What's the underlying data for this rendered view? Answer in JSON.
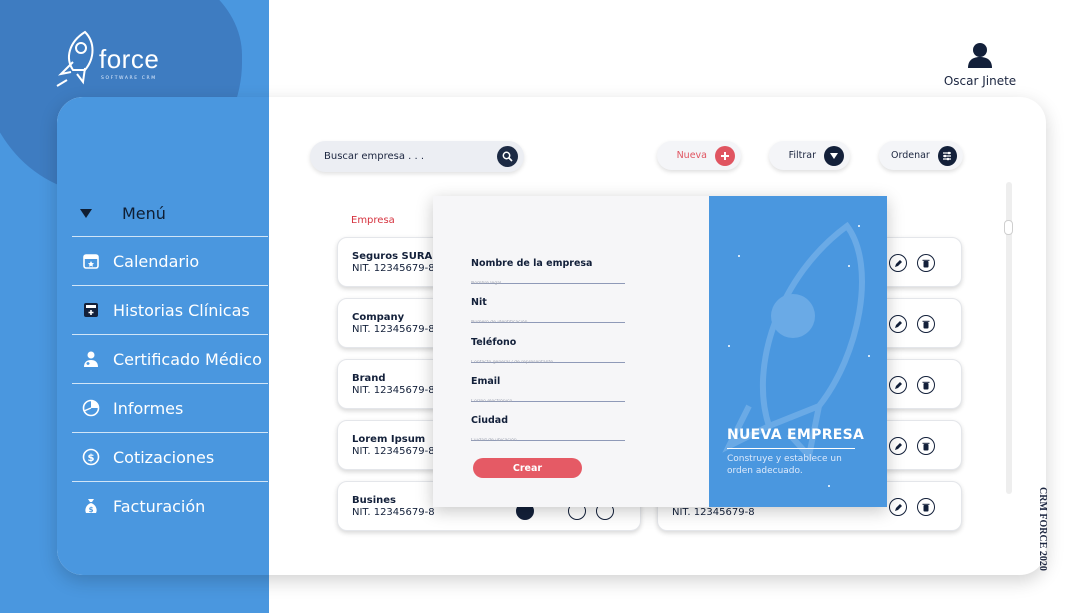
{
  "brand": {
    "logo_text": "force",
    "logo_subtitle": "SOFTWARE CRM",
    "footer_vertical": "CRM FORCE 2020"
  },
  "user": {
    "name": "Oscar Jinete"
  },
  "menu": {
    "title": "Menú",
    "items": [
      {
        "label": "Calendario",
        "icon": "calendar-icon"
      },
      {
        "label": "Historias Clínicas",
        "icon": "medical-record-icon"
      },
      {
        "label": "Certificado Médico",
        "icon": "doctor-icon"
      },
      {
        "label": "Informes",
        "icon": "report-icon"
      },
      {
        "label": "Cotizaciones",
        "icon": "quote-icon"
      },
      {
        "label": "Facturación",
        "icon": "money-bag-icon"
      }
    ]
  },
  "toolbar": {
    "search_placeholder": "Buscar empresa . . .",
    "new_label": "Nueva",
    "filter_label": "Filtrar",
    "sort_label": "Ordenar"
  },
  "list": {
    "column_header": "Empresa",
    "rows": [
      {
        "name": "Seguros SURA",
        "nit": "NIT. 12345679-8"
      },
      {
        "name": "Company",
        "nit": "NIT. 12345679-8"
      },
      {
        "name": "Brand",
        "nit": "NIT. 12345679-8"
      },
      {
        "name": "Lorem Ipsum",
        "nit": "NIT. 12345679-8"
      },
      {
        "name": "Busines",
        "nit": "NIT. 12345679-8"
      }
    ],
    "right_partial_nit": "NIT. 12345679-8"
  },
  "modal": {
    "fields": [
      {
        "label": "Nombre de la empresa",
        "placeholder": "Nombre legal"
      },
      {
        "label": "Nit",
        "placeholder": "Número de identificación"
      },
      {
        "label": "Teléfono",
        "placeholder": "Contacto general / de representante"
      },
      {
        "label": "Email",
        "placeholder": "Correo electrónico"
      },
      {
        "label": "Ciudad",
        "placeholder": "Ciudad de ubicación"
      }
    ],
    "submit_label": "Crear",
    "panel_title": "NUEVA EMPRESA",
    "panel_subtitle": "Construye y establece un orden adecuado."
  },
  "colors": {
    "sidebar": "#4a97df",
    "sidebar_dark": "#3e7cc1",
    "navy": "#13203a",
    "accent_red": "#e05561",
    "header_red": "#d6333f"
  }
}
